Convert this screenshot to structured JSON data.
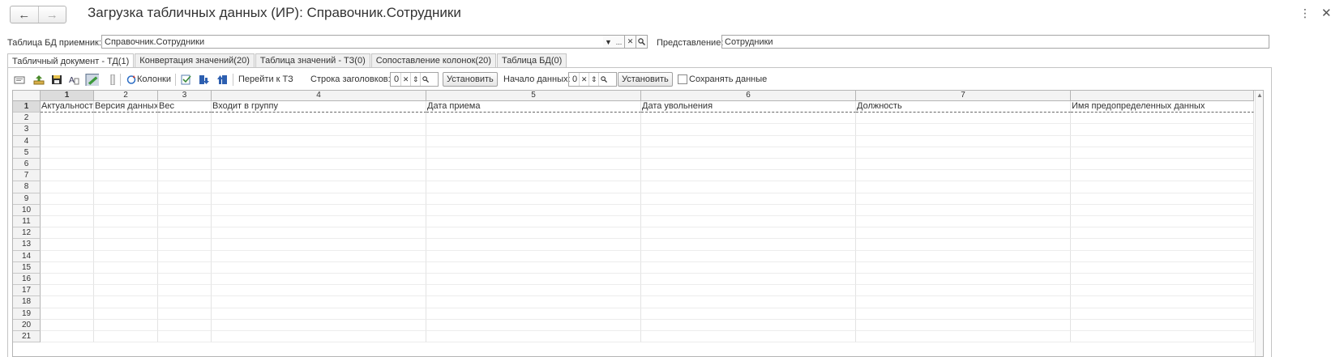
{
  "window": {
    "title": "Загрузка табличных данных (ИР): Справочник.Сотрудники",
    "back_icon": "←",
    "forward_icon": "→",
    "more_icon": "⋮",
    "close_icon": "✕"
  },
  "receiver": {
    "label": "Таблица БД приемник:",
    "value": "Справочник.Сотрудники",
    "buttons": [
      "▼",
      "...",
      "✕",
      "🔍"
    ]
  },
  "representation": {
    "label": "Представление:",
    "value": "Сотрудники"
  },
  "tabs": [
    {
      "label": "Табличный документ - ТД(1)",
      "active": true
    },
    {
      "label": "Конвертация значений(20)",
      "active": false
    },
    {
      "label": "Таблица значений - ТЗ(0)",
      "active": false
    },
    {
      "label": "Сопоставление колонок(20)",
      "active": false
    },
    {
      "label": "Таблица БД(0)",
      "active": false
    }
  ],
  "toolbar": {
    "columns_label": "Колонки",
    "goto_tz_label": "Перейти к ТЗ",
    "header_row_label": "Строка заголовков:",
    "header_row_value": "0",
    "set_button_1": "Установить",
    "data_start_label": "Начало данных:",
    "data_start_value": "0",
    "set_button_2": "Установить",
    "save_data_label": "Сохранять данные",
    "save_data_checked": false,
    "icons": [
      "clear-icon",
      "load-file-icon",
      "save-file-icon",
      "font-icon",
      "edit-mode-icon",
      "row-marker-icon",
      "refresh-columns-icon",
      "check-list-icon",
      "download-icon",
      "upload-icon"
    ]
  },
  "sheet": {
    "column_headers": [
      "1",
      "2",
      "3",
      "4",
      "5",
      "6",
      "7"
    ],
    "row_numbers": [
      "1",
      "2",
      "3",
      "4",
      "5",
      "6",
      "7",
      "8",
      "9",
      "10",
      "11",
      "12",
      "13",
      "14",
      "15",
      "16",
      "17",
      "18",
      "19",
      "20",
      "21"
    ],
    "header_cells": [
      "Актуальность",
      "Версия данных",
      "Вес",
      "Входит в группу",
      "Дата приема",
      "Дата увольнения",
      "Должность",
      "Имя предопределенных данных"
    ]
  }
}
